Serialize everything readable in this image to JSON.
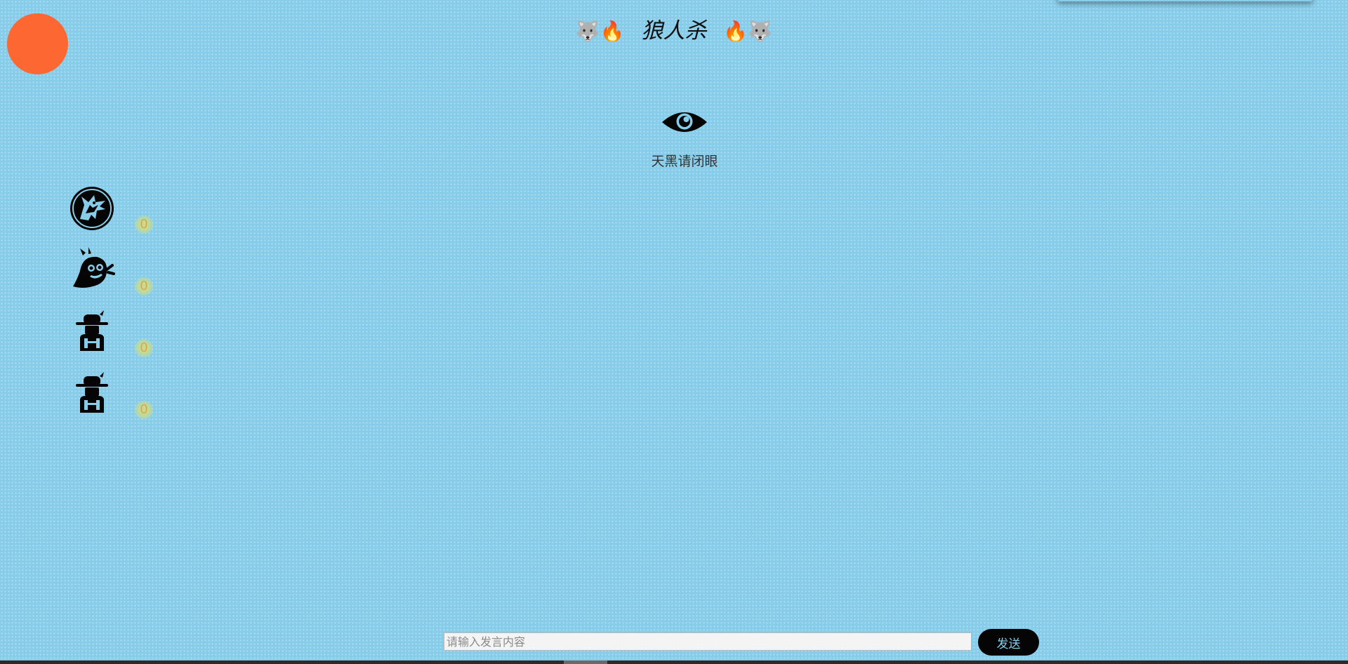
{
  "header": {
    "title": "狼人杀",
    "left_emoji": "🐺🔥",
    "right_emoji": "🔥🐺"
  },
  "phase": {
    "icon": "eye-icon",
    "text": "天黑请闭眼"
  },
  "players": [
    {
      "role_icon": "werewolf-icon",
      "votes": "0"
    },
    {
      "role_icon": "ghost-icon",
      "votes": "0"
    },
    {
      "role_icon": "farmer-icon",
      "votes": "0"
    },
    {
      "role_icon": "farmer-icon",
      "votes": "0"
    }
  ],
  "chat": {
    "placeholder": "请输入发言内容",
    "value": "",
    "send_label": "发送"
  },
  "colors": {
    "background": "#87cdea",
    "sun": "#fd6832",
    "send_button": "#050505",
    "send_text": "#87cdea"
  }
}
